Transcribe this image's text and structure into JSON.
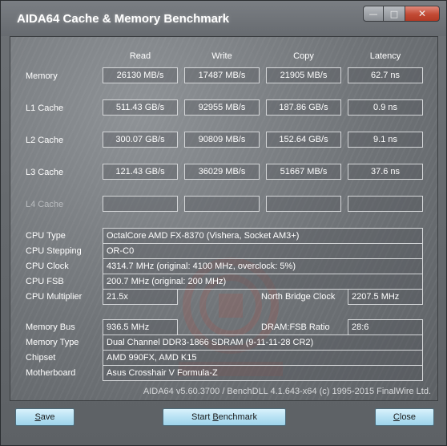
{
  "window": {
    "title": "AIDA64 Cache & Memory Benchmark",
    "minimize_icon": "minimize-icon",
    "maximize_icon": "maximize-icon",
    "close_icon": "close-icon"
  },
  "columns": {
    "read": "Read",
    "write": "Write",
    "copy": "Copy",
    "latency": "Latency"
  },
  "rows": {
    "memory": {
      "label": "Memory",
      "read": "26130 MB/s",
      "write": "17487 MB/s",
      "copy": "21905 MB/s",
      "latency": "62.7 ns"
    },
    "l1": {
      "label": "L1 Cache",
      "read": "511.43 GB/s",
      "write": "92955 MB/s",
      "copy": "187.86 GB/s",
      "latency": "0.9 ns"
    },
    "l2": {
      "label": "L2 Cache",
      "read": "300.07 GB/s",
      "write": "90809 MB/s",
      "copy": "152.64 GB/s",
      "latency": "9.1 ns"
    },
    "l3": {
      "label": "L3 Cache",
      "read": "121.43 GB/s",
      "write": "36029 MB/s",
      "copy": "51667 MB/s",
      "latency": "37.6 ns"
    },
    "l4": {
      "label": "L4 Cache",
      "read": "",
      "write": "",
      "copy": "",
      "latency": ""
    }
  },
  "info": {
    "cpu_type": {
      "label": "CPU Type",
      "value": "OctalCore AMD FX-8370  (Vishera, Socket AM3+)"
    },
    "cpu_stepping": {
      "label": "CPU Stepping",
      "value": "OR-C0"
    },
    "cpu_clock": {
      "label": "CPU Clock",
      "value": "4314.7 MHz  (original: 4100 MHz, overclock: 5%)"
    },
    "cpu_fsb": {
      "label": "CPU FSB",
      "value": "200.7 MHz  (original: 200 MHz)"
    },
    "cpu_multiplier": {
      "label": "CPU Multiplier",
      "value": "21.5x"
    },
    "north_bridge_clock": {
      "label": "North Bridge Clock",
      "value": "2207.5 MHz"
    },
    "memory_bus": {
      "label": "Memory Bus",
      "value": "936.5 MHz"
    },
    "dram_fsb_ratio": {
      "label": "DRAM:FSB Ratio",
      "value": "28:6"
    },
    "memory_type": {
      "label": "Memory Type",
      "value": "Dual Channel DDR3-1866 SDRAM  (9-11-11-28 CR2)"
    },
    "chipset": {
      "label": "Chipset",
      "value": "AMD 990FX, AMD K15"
    },
    "motherboard": {
      "label": "Motherboard",
      "value": "Asus Crosshair V Formula-Z"
    }
  },
  "footer": "AIDA64 v5.60.3700 / BenchDLL 4.1.643-x64  (c) 1995-2015 FinalWire Ltd.",
  "buttons": {
    "save_mn": "S",
    "save_rest": "ave",
    "start_pre": "Start ",
    "start_mn": "B",
    "start_rest": "enchmark",
    "close_mn": "C",
    "close_rest": "lose"
  },
  "watermark_icon": "vmodtech-logo-icon"
}
